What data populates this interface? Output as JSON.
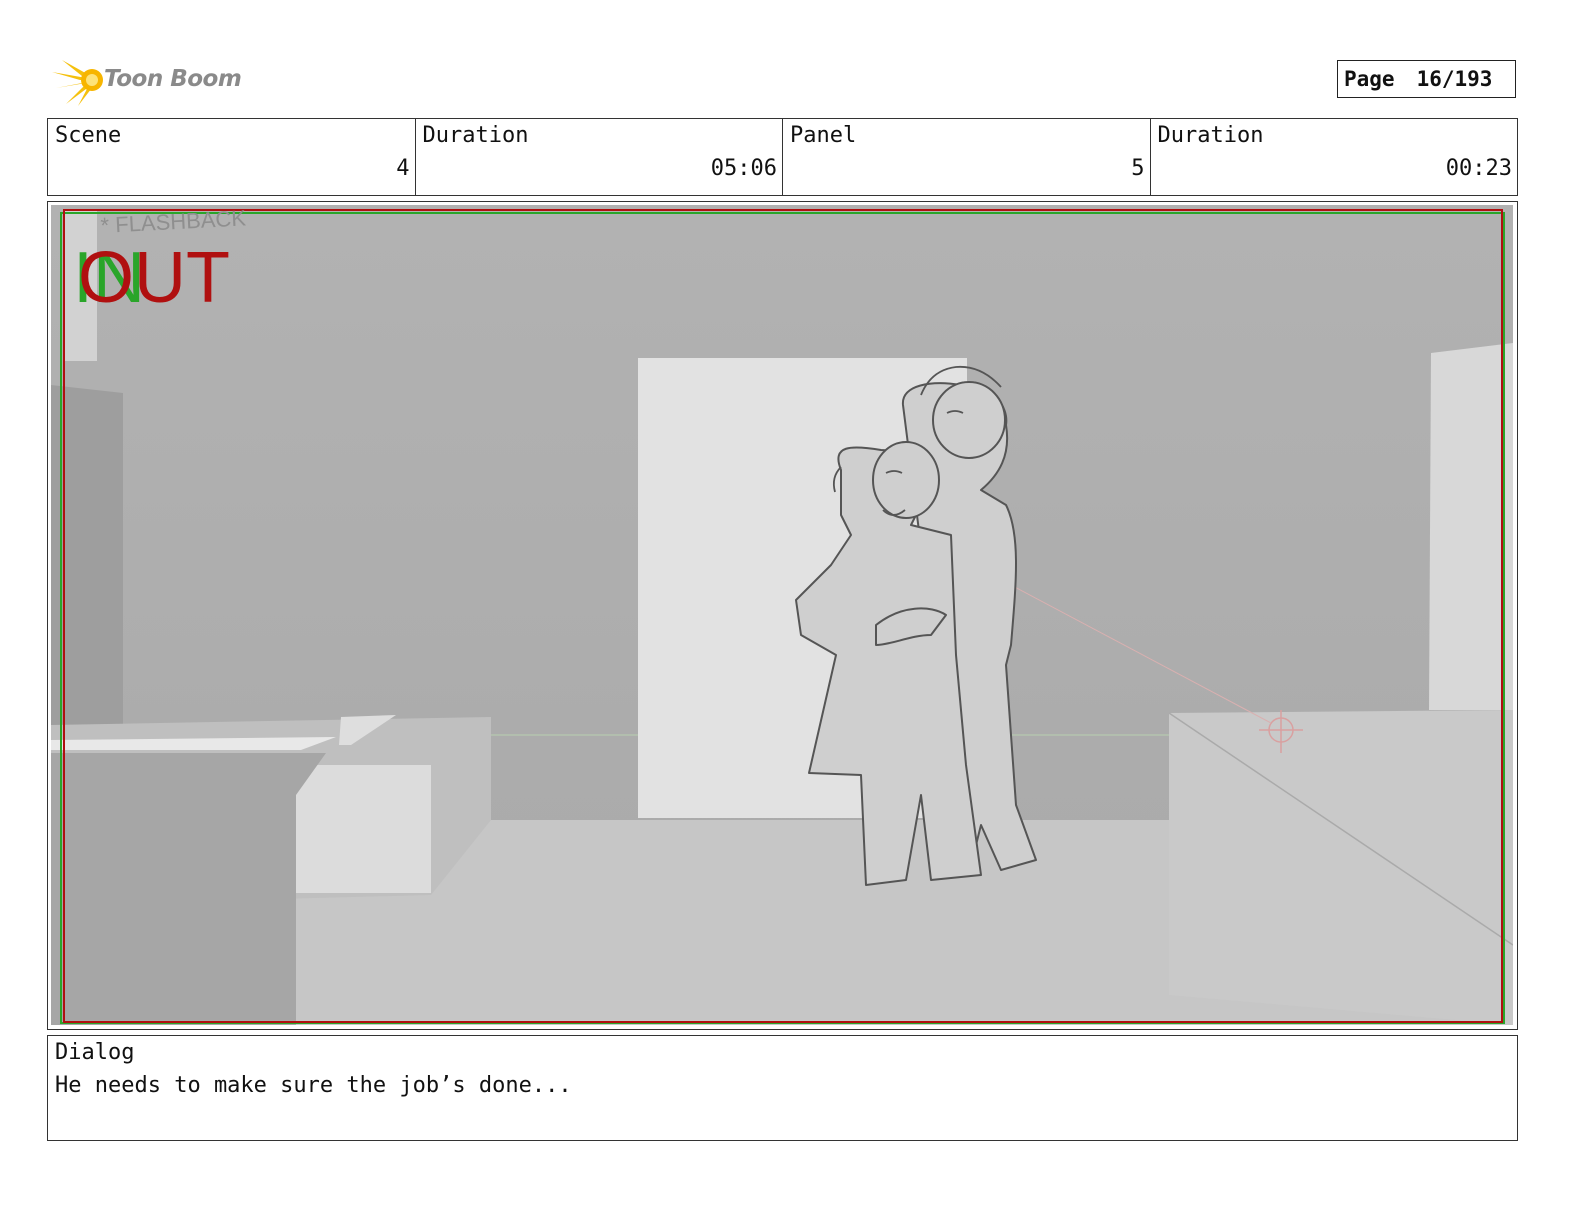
{
  "brand": {
    "name": "Toon Boom"
  },
  "page": {
    "label": "Page",
    "value": "16/193"
  },
  "header": {
    "scene_label": "Scene",
    "scene_value": "4",
    "scene_duration_label": "Duration",
    "scene_duration_value": "05:06",
    "panel_label": "Panel",
    "panel_value": "5",
    "panel_duration_label": "Duration",
    "panel_duration_value": "00:23"
  },
  "panel_image": {
    "note": "* FLASHBACK",
    "in_marker": "IN",
    "out_marker": "OUT",
    "in_color": "#2aa52a",
    "out_color": "#b01010"
  },
  "dialog": {
    "label": "Dialog",
    "text": "He needs to make sure the job’s done..."
  }
}
